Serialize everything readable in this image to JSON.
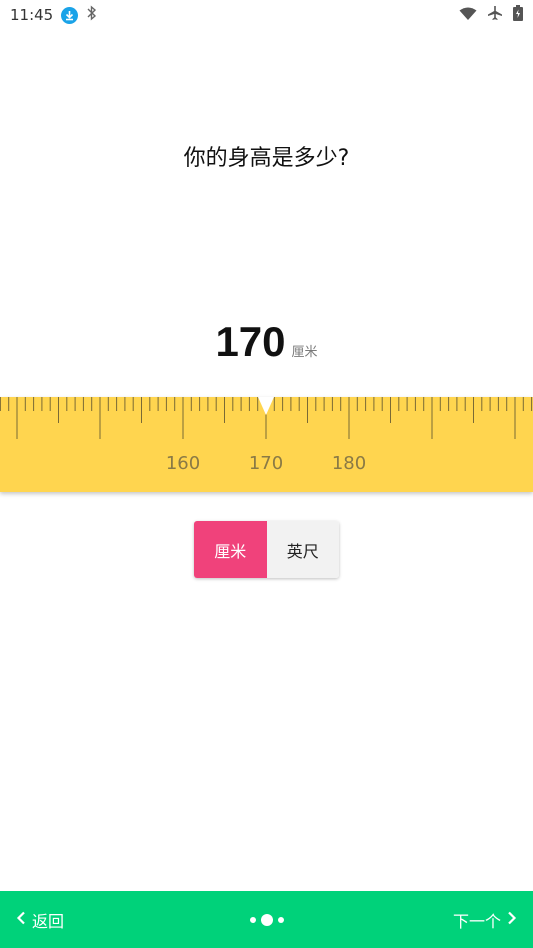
{
  "status_bar": {
    "time": "11:45",
    "icons": [
      "download-icon",
      "bluetooth-icon",
      "wifi-icon",
      "airplane-icon",
      "battery-icon"
    ]
  },
  "question": "你的身高是多少?",
  "readout": {
    "value": "170",
    "unit": "厘米"
  },
  "ruler": {
    "current_value": 170,
    "tick_labels": [
      "160",
      "170",
      "180"
    ],
    "colors": {
      "background": "#ffd54f",
      "tick": "#7a6a35",
      "label": "#8a7a45",
      "pointer": "#ffffff"
    }
  },
  "unit_toggle": {
    "options": [
      "厘米",
      "英尺"
    ],
    "selected": "厘米",
    "active_color": "#f0427b"
  },
  "bottom_nav": {
    "back_label": "返回",
    "next_label": "下一个",
    "current_page": 2,
    "page_count": 3,
    "color": "#00d27a"
  }
}
